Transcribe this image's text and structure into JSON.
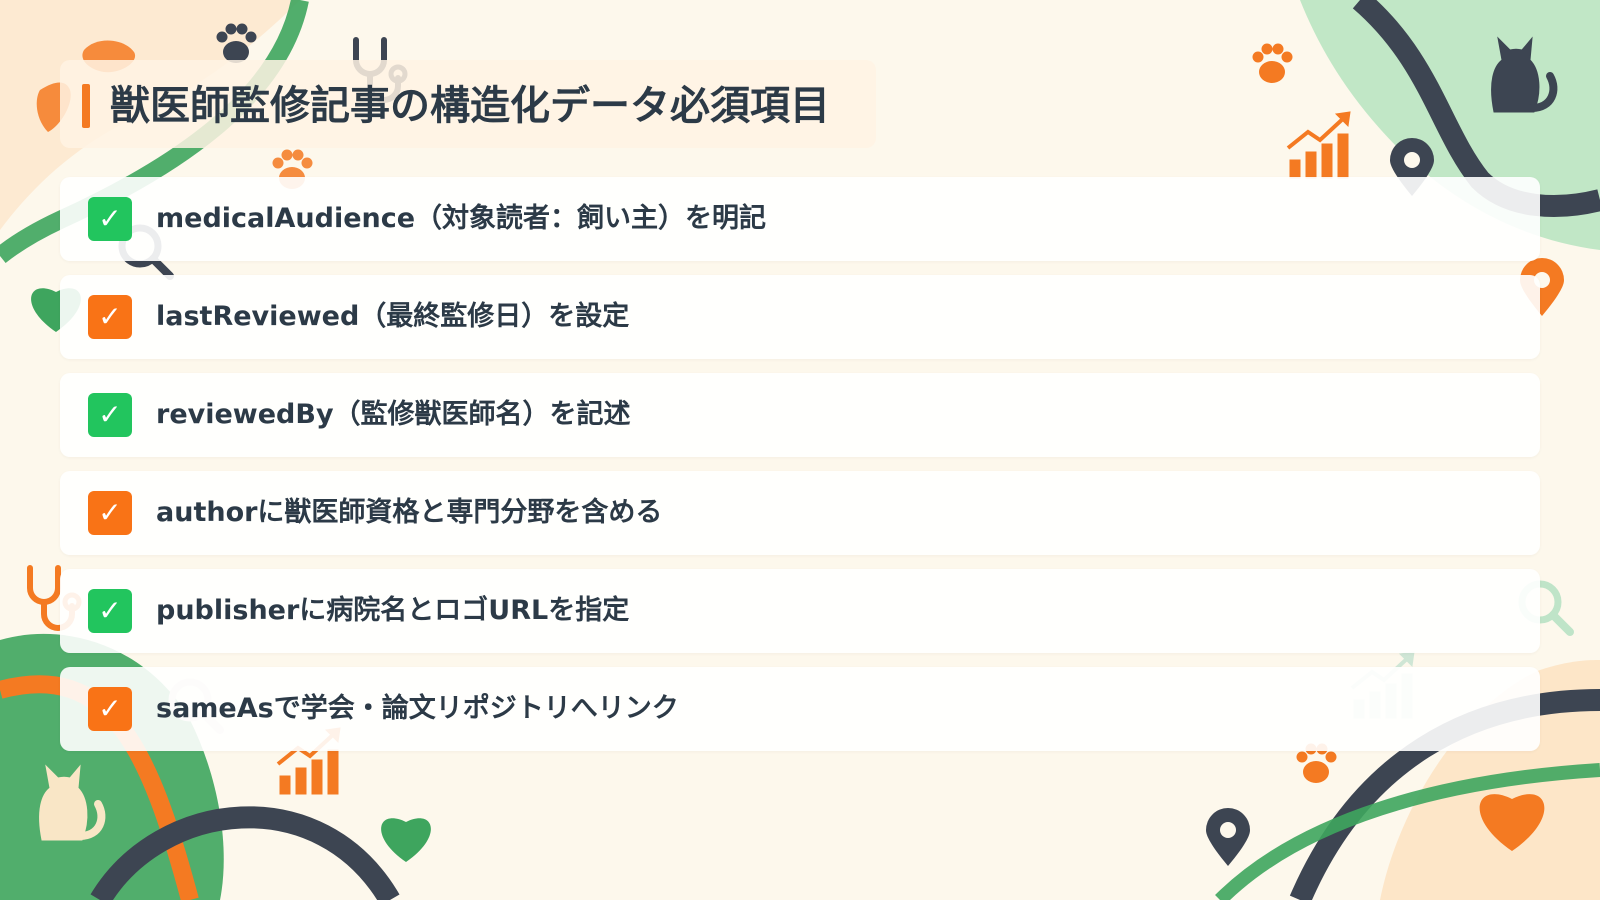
{
  "title": "獣医師監修記事の構造化データ必須項目",
  "colors": {
    "accent_orange": "#f47a22",
    "check_green": "#22c55e",
    "check_orange": "#f97316",
    "text": "#2c3a47",
    "deco_green": "#3ea55e",
    "deco_dark": "#3d4552",
    "background": "#fdf8ec"
  },
  "checklist": [
    {
      "label": "medicalAudience（対象読者：飼い主）を明記",
      "check": "✓",
      "check_color": "green"
    },
    {
      "label": "lastReviewed（最終監修日）を設定",
      "check": "✓",
      "check_color": "orange"
    },
    {
      "label": "reviewedBy（監修獣医師名）を記述",
      "check": "✓",
      "check_color": "green"
    },
    {
      "label": "authorに獣医師資格と専門分野を含める",
      "check": "✓",
      "check_color": "orange"
    },
    {
      "label": "publisherに病院名とロゴURLを指定",
      "check": "✓",
      "check_color": "green"
    },
    {
      "label": "sameAsで学会・論文リポジトリへリンク",
      "check": "✓",
      "check_color": "orange"
    }
  ],
  "decorations": {
    "icons": [
      "paw-print-icon",
      "cat-icon",
      "heart-icon",
      "stethoscope-icon",
      "magnifier-icon",
      "bar-chart-up-icon",
      "map-pin-icon"
    ]
  }
}
